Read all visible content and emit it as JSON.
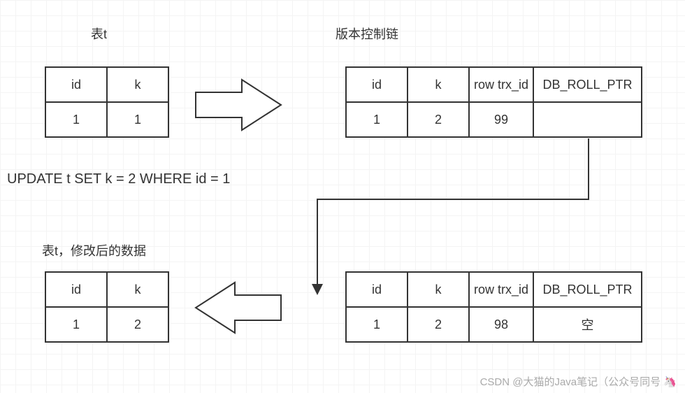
{
  "titles": {
    "left_top": "表t",
    "right_top": "版本控制链",
    "left_bottom": "表t，修改后的数据"
  },
  "table_left_top": {
    "h1": "id",
    "h2": "k",
    "r1c1": "1",
    "r1c2": "1"
  },
  "table_left_bottom": {
    "h1": "id",
    "h2": "k",
    "r1c1": "1",
    "r1c2": "2"
  },
  "table_right_top": {
    "h1": "id",
    "h2": "k",
    "h3": "row trx_id",
    "h4": "DB_ROLL_PTR",
    "r1c1": "1",
    "r1c2": "2",
    "r1c3": "99",
    "r1c4": ""
  },
  "table_right_bottom": {
    "h1": "id",
    "h2": "k",
    "h3": "row trx_id",
    "h4": "DB_ROLL_PTR",
    "r1c1": "1",
    "r1c2": "2",
    "r1c3": "98",
    "r1c4": "空"
  },
  "sql": "UPDATE t SET k = 2 WHERE id = 1",
  "watermark": "CSDN @大猫的Java笔记（公众号同号 🦄"
}
